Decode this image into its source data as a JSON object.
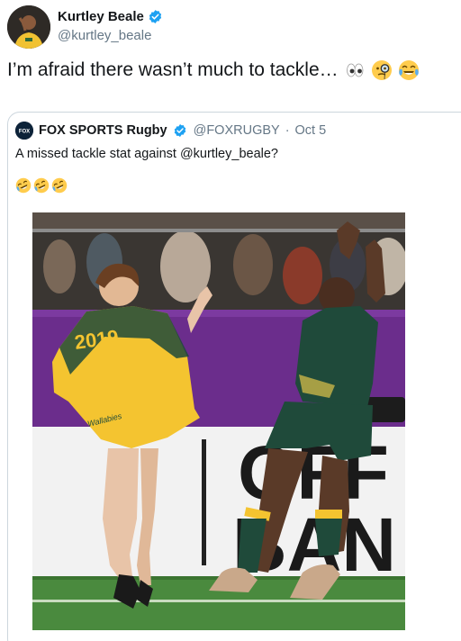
{
  "tweet": {
    "display_name": "Kurtley Beale",
    "handle": "@kurtley_beale",
    "text": "I’m afraid there wasn’t much to tackle…",
    "emojis": [
      "eyes-icon",
      "monocle-face-icon",
      "tears-of-joy-icon"
    ]
  },
  "quoted_tweet": {
    "display_name": "FOX SPORTS Rugby",
    "handle": "@FOXRUGBY",
    "separator": "·",
    "date": "Oct 5",
    "text": "A missed tackle stat against @kurtley_beale?",
    "emojis": [
      "rolling-laughing-icon",
      "rolling-laughing-icon",
      "rolling-laughing-icon"
    ],
    "avatar_text": "FOX"
  },
  "photo": {
    "jersey_number": "2019",
    "jersey_word": "Wallabies",
    "board_text_top": "OFF",
    "board_text_bottom": "BAN"
  },
  "colors": {
    "verified": "#1da1f2",
    "gold": "#f4c430",
    "green": "#1f4a3a",
    "purple": "#6b2d8c"
  }
}
